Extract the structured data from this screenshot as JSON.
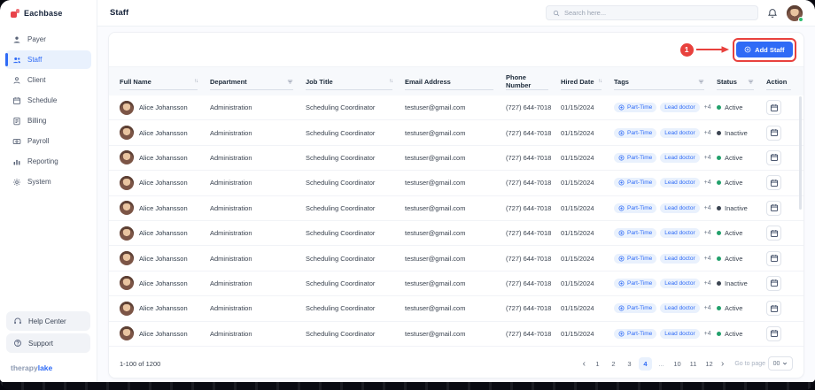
{
  "app": {
    "name": "Eachbase",
    "page_title": "Staff"
  },
  "colors": {
    "accent": "#2f6bf6",
    "logo_red": "#e8424a",
    "annotation_red": "#e8413d",
    "active_green": "#22a06b"
  },
  "header": {
    "search_placeholder": "Search here..."
  },
  "sidebar": {
    "items": [
      {
        "label": "Payer",
        "icon": "payer-icon",
        "active": false
      },
      {
        "label": "Staff",
        "icon": "staff-icon",
        "active": true
      },
      {
        "label": "Client",
        "icon": "client-icon",
        "active": false
      },
      {
        "label": "Schedule",
        "icon": "schedule-icon",
        "active": false
      },
      {
        "label": "Billing",
        "icon": "billing-icon",
        "active": false
      },
      {
        "label": "Payroll",
        "icon": "payroll-icon",
        "active": false
      },
      {
        "label": "Reporting",
        "icon": "reporting-icon",
        "active": false
      },
      {
        "label": "System",
        "icon": "system-icon",
        "active": false
      }
    ],
    "footer_items": [
      {
        "label": "Help Center",
        "icon": "help-center-icon"
      },
      {
        "label": "Support",
        "icon": "support-icon"
      }
    ],
    "brand": {
      "part1": "therapy",
      "part2": "lake"
    }
  },
  "toolbar": {
    "add_staff_label": "Add Staff"
  },
  "annotation": {
    "step": "1"
  },
  "table": {
    "columns": [
      {
        "label": "Full Name",
        "control": "sort"
      },
      {
        "label": "Department",
        "control": "filter"
      },
      {
        "label": "Job Title",
        "control": "sort"
      },
      {
        "label": "Email Address",
        "control": "none"
      },
      {
        "label": "Phone Number",
        "control": "none"
      },
      {
        "label": "Hired Date",
        "control": "sort"
      },
      {
        "label": "Tags",
        "control": "filter"
      },
      {
        "label": "Status",
        "control": "filter"
      },
      {
        "label": "Action",
        "control": "none"
      }
    ],
    "rows": [
      {
        "full_name": "Alice Johansson",
        "department": "Administration",
        "job_title": "Scheduling Coordinator",
        "email": "testuser@gmail.com",
        "phone": "(727) 644-7018",
        "hired_date": "01/15/2024",
        "tags": [
          "Part-Time",
          "Lead doctor"
        ],
        "extra_tags": "+4",
        "status": "Active"
      },
      {
        "full_name": "Alice Johansson",
        "department": "Administration",
        "job_title": "Scheduling Coordinator",
        "email": "testuser@gmail.com",
        "phone": "(727) 644-7018",
        "hired_date": "01/15/2024",
        "tags": [
          "Part-Time",
          "Lead doctor"
        ],
        "extra_tags": "+4",
        "status": "Inactive"
      },
      {
        "full_name": "Alice Johansson",
        "department": "Administration",
        "job_title": "Scheduling Coordinator",
        "email": "testuser@gmail.com",
        "phone": "(727) 644-7018",
        "hired_date": "01/15/2024",
        "tags": [
          "Part-Time",
          "Lead doctor"
        ],
        "extra_tags": "+4",
        "status": "Active"
      },
      {
        "full_name": "Alice Johansson",
        "department": "Administration",
        "job_title": "Scheduling Coordinator",
        "email": "testuser@gmail.com",
        "phone": "(727) 644-7018",
        "hired_date": "01/15/2024",
        "tags": [
          "Part-Time",
          "Lead doctor"
        ],
        "extra_tags": "+4",
        "status": "Active"
      },
      {
        "full_name": "Alice Johansson",
        "department": "Administration",
        "job_title": "Scheduling Coordinator",
        "email": "testuser@gmail.com",
        "phone": "(727) 644-7018",
        "hired_date": "01/15/2024",
        "tags": [
          "Part-Time",
          "Lead doctor"
        ],
        "extra_tags": "+4",
        "status": "Inactive"
      },
      {
        "full_name": "Alice Johansson",
        "department": "Administration",
        "job_title": "Scheduling Coordinator",
        "email": "testuser@gmail.com",
        "phone": "(727) 644-7018",
        "hired_date": "01/15/2024",
        "tags": [
          "Part-Time",
          "Lead doctor"
        ],
        "extra_tags": "+4",
        "status": "Active"
      },
      {
        "full_name": "Alice Johansson",
        "department": "Administration",
        "job_title": "Scheduling Coordinator",
        "email": "testuser@gmail.com",
        "phone": "(727) 644-7018",
        "hired_date": "01/15/2024",
        "tags": [
          "Part-Time",
          "Lead doctor"
        ],
        "extra_tags": "+4",
        "status": "Active"
      },
      {
        "full_name": "Alice Johansson",
        "department": "Administration",
        "job_title": "Scheduling Coordinator",
        "email": "testuser@gmail.com",
        "phone": "(727) 644-7018",
        "hired_date": "01/15/2024",
        "tags": [
          "Part-Time",
          "Lead doctor"
        ],
        "extra_tags": "+4",
        "status": "Inactive"
      },
      {
        "full_name": "Alice Johansson",
        "department": "Administration",
        "job_title": "Scheduling Coordinator",
        "email": "testuser@gmail.com",
        "phone": "(727) 644-7018",
        "hired_date": "01/15/2024",
        "tags": [
          "Part-Time",
          "Lead doctor"
        ],
        "extra_tags": "+4",
        "status": "Active"
      },
      {
        "full_name": "Alice Johansson",
        "department": "Administration",
        "job_title": "Scheduling Coordinator",
        "email": "testuser@gmail.com",
        "phone": "(727) 644-7018",
        "hired_date": "01/15/2024",
        "tags": [
          "Part-Time",
          "Lead doctor"
        ],
        "extra_tags": "+4",
        "status": "Active"
      }
    ]
  },
  "pagination": {
    "range_text": "1-100 of 1200",
    "pages": [
      "1",
      "2",
      "3",
      "4",
      "...",
      "10",
      "11",
      "12"
    ],
    "current_page": "4",
    "go_to_label": "Go to page",
    "page_select_value": "00"
  },
  "icons": {
    "sort": "↑↓",
    "chevron_left": "‹",
    "chevron_right": "›"
  }
}
